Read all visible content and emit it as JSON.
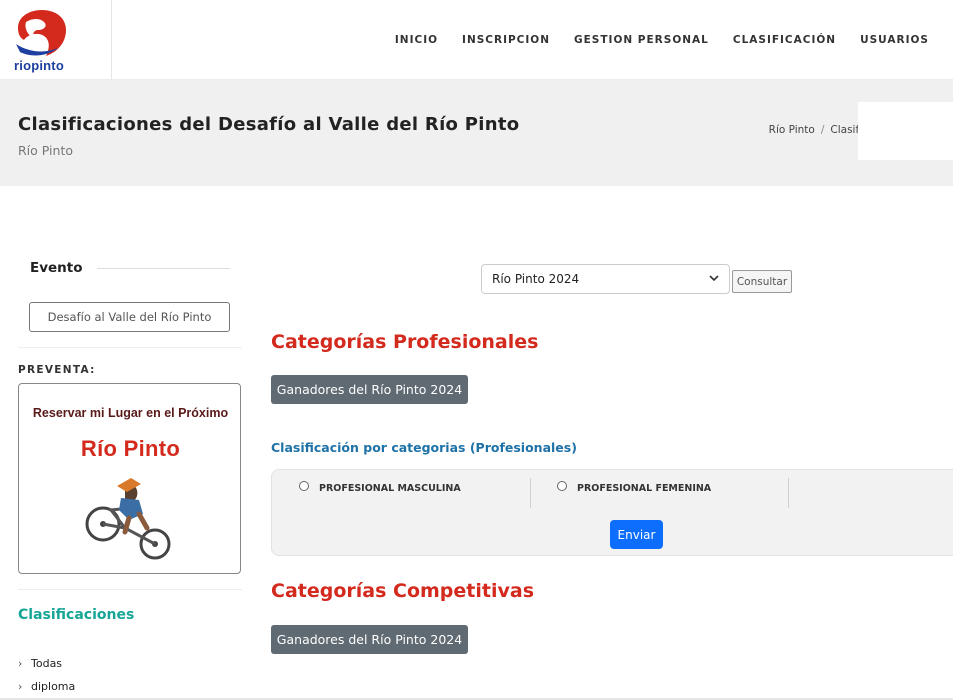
{
  "brand": {
    "logo_text": "riopinto",
    "primary_color": "#d42a1e",
    "logo_blue": "#1e3fa0"
  },
  "nav": {
    "items": [
      "INICIO",
      "INSCRIPCION",
      "GESTION PERSONAL",
      "CLASIFICACIÓN",
      "USUARIOS"
    ]
  },
  "page": {
    "title": "Clasificaciones del Desafío al Valle del Río Pinto",
    "subtitle": "Río Pinto",
    "breadcrumb": [
      "Río Pinto",
      "Clasificaciones"
    ],
    "breadcrumb_sep": "/"
  },
  "sidebar": {
    "event_title": "Evento",
    "event_button": "Desafío al Valle del Río Pinto",
    "preventa_label": "PREVENTA:",
    "promo": {
      "line1": "Reservar mi Lugar en el Próximo",
      "line2": "Río Pinto"
    },
    "clasificaciones_title": "Clasificaciones",
    "links": [
      "Todas",
      "diploma"
    ]
  },
  "main": {
    "year_select": {
      "value": "Río Pinto 2024"
    },
    "consultar_label": "Consultar",
    "profesionales": {
      "heading": "Categorías Profesionales",
      "winners_button": "Ganadores del Río Pinto 2024",
      "sub_heading": "Clasificación por categorias (Profesionales)",
      "options": [
        "PROFESIONAL MASCULINA",
        "PROFESIONAL FEMENINA"
      ],
      "submit_label": "Enviar"
    },
    "competitivas": {
      "heading": "Categorías Competitivas",
      "winners_button": "Ganadores del Río Pinto 2024"
    }
  }
}
